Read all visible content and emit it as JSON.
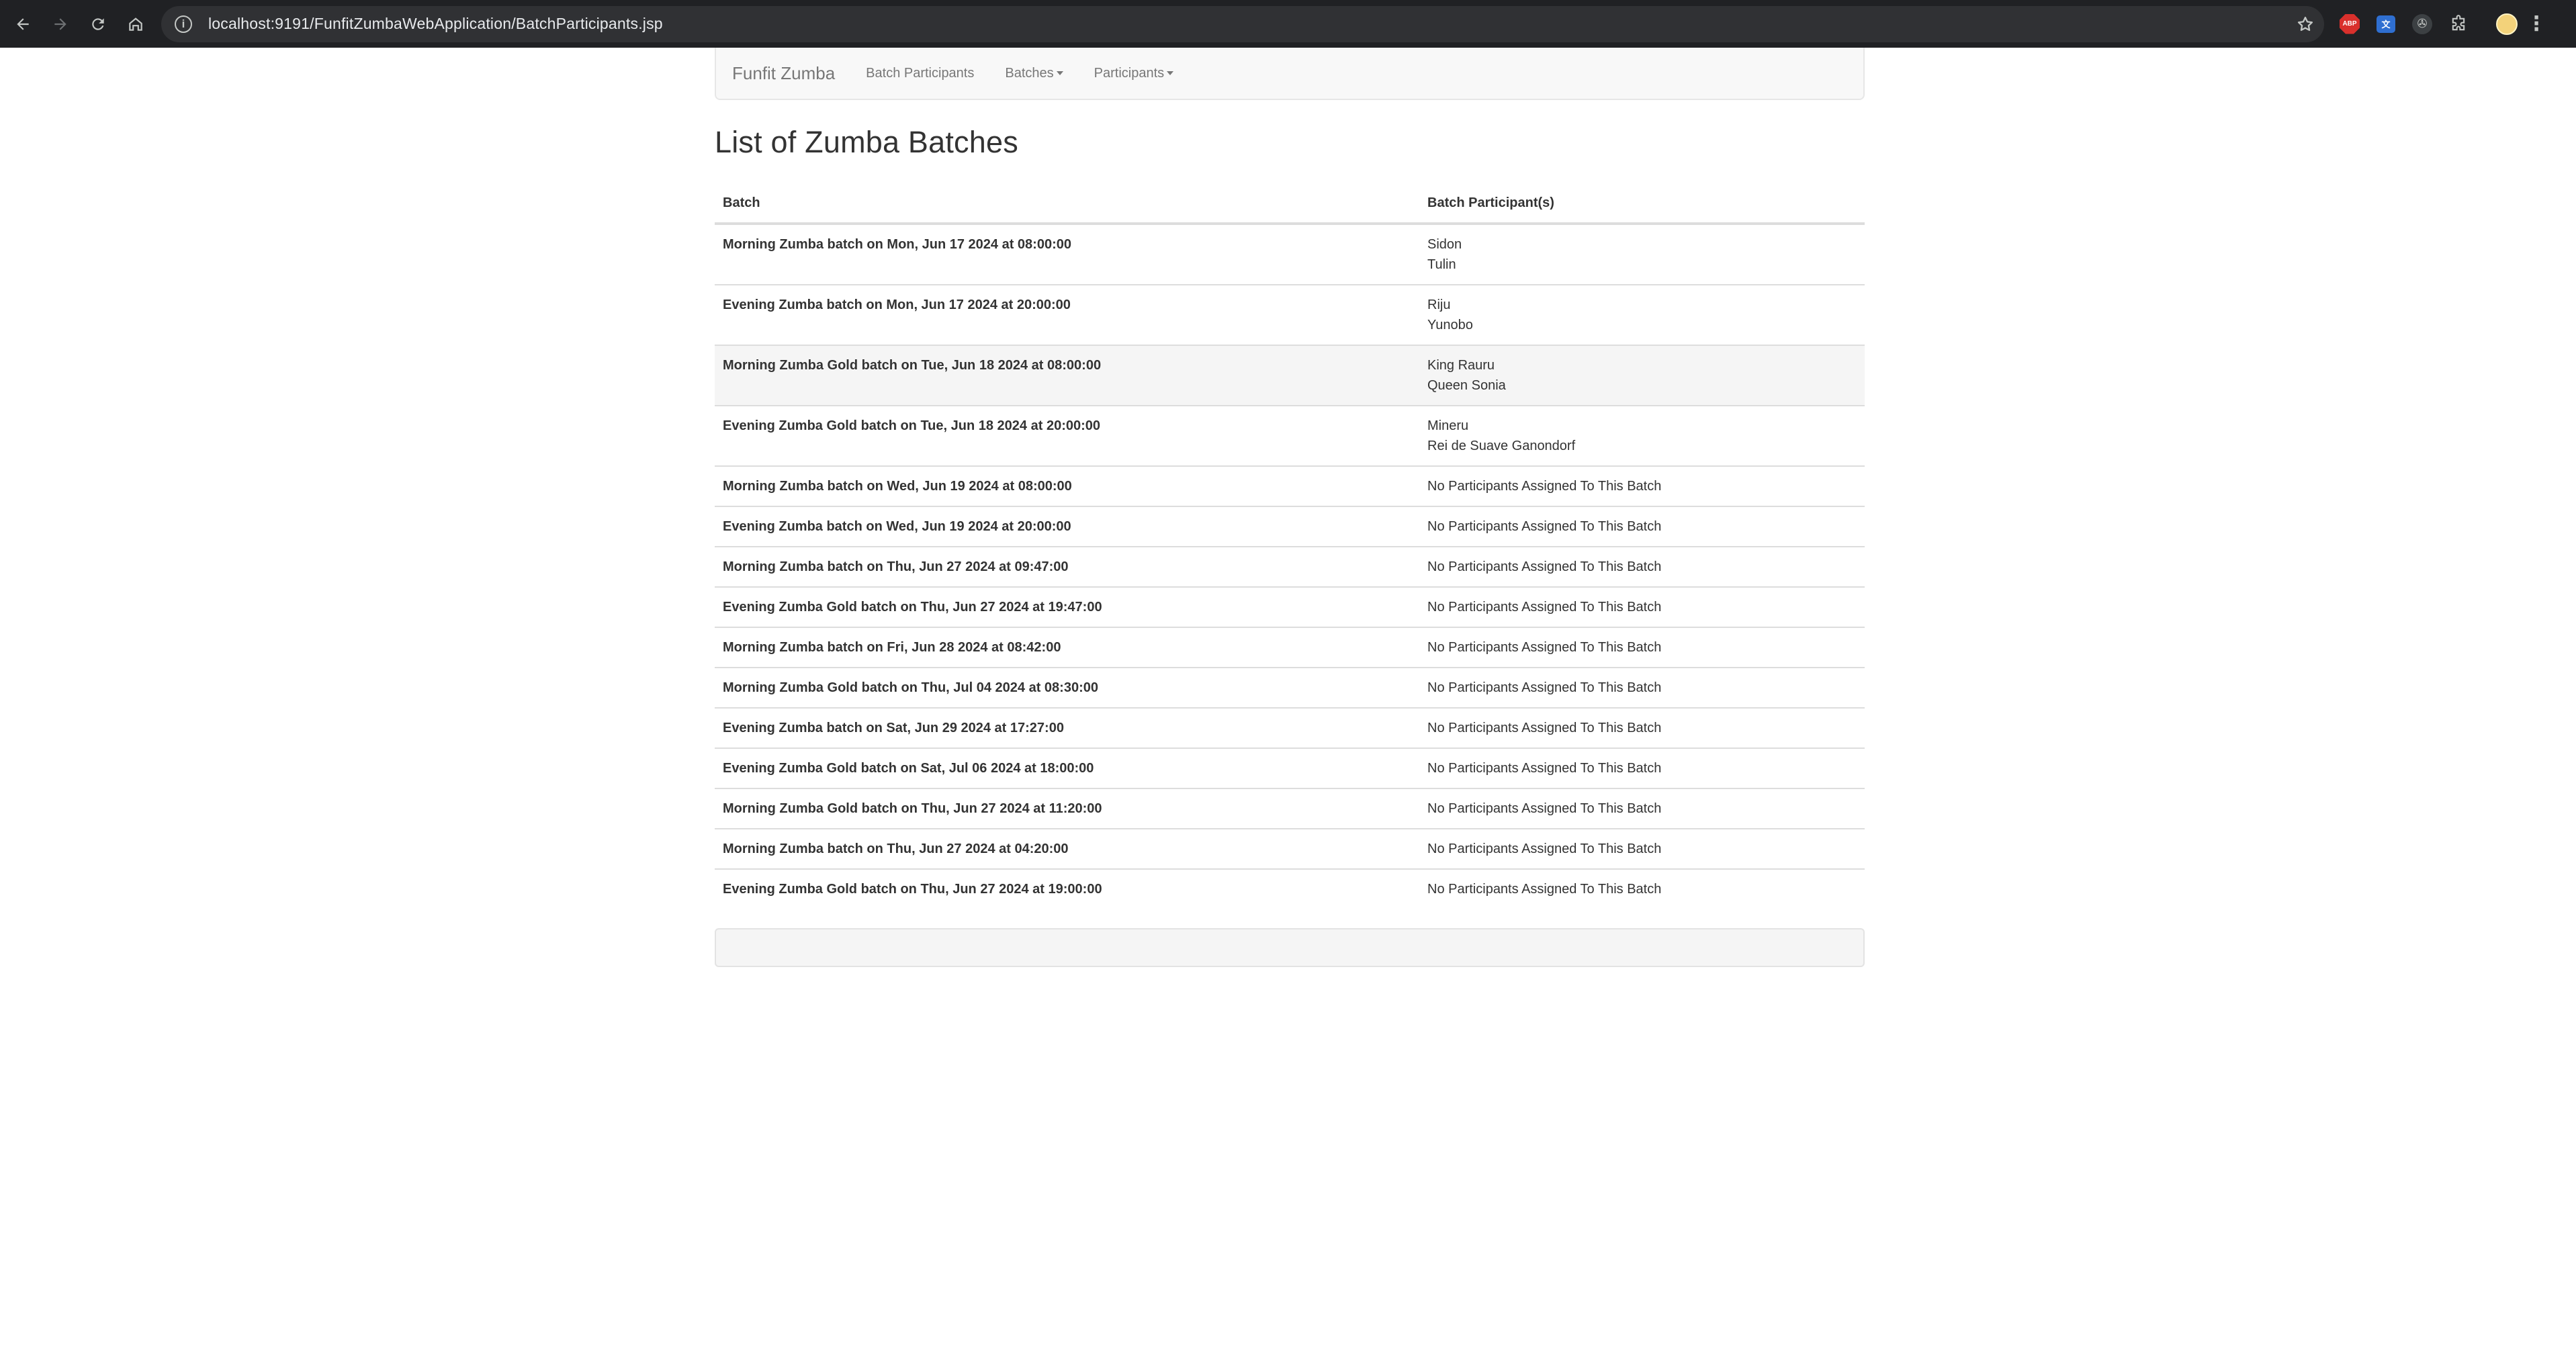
{
  "browser": {
    "url": "localhost:9191/FunfitZumbaWebApplication/BatchParticipants.jsp",
    "extensions": [
      "abp-icon",
      "translate-extension-icon",
      "dark-extension-icon",
      "puzzle-icon"
    ]
  },
  "navbar": {
    "brand": "Funfit Zumba",
    "items": [
      {
        "label": "Batch Participants",
        "dropdown": false
      },
      {
        "label": "Batches",
        "dropdown": true
      },
      {
        "label": "Participants",
        "dropdown": true
      }
    ]
  },
  "page": {
    "title": "List of Zumba Batches"
  },
  "table": {
    "headers": [
      "Batch",
      "Batch Participant(s)"
    ],
    "rows": [
      {
        "batch": "Morning Zumba batch on Mon, Jun 17 2024 at 08:00:00",
        "participants": [
          "Sidon",
          "Tulin"
        ]
      },
      {
        "batch": "Evening Zumba batch on Mon, Jun 17 2024 at 20:00:00",
        "participants": [
          "Riju",
          "Yunobo"
        ]
      },
      {
        "batch": "Morning Zumba Gold batch on Tue, Jun 18 2024 at 08:00:00",
        "participants": [
          "King Rauru",
          "Queen Sonia"
        ]
      },
      {
        "batch": "Evening Zumba Gold batch on Tue, Jun 18 2024 at 20:00:00",
        "participants": [
          "Mineru",
          "Rei de Suave Ganondorf"
        ]
      },
      {
        "batch": "Morning Zumba batch on Wed, Jun 19 2024 at 08:00:00",
        "participants": [
          "No Participants Assigned To This Batch"
        ]
      },
      {
        "batch": "Evening Zumba batch on Wed, Jun 19 2024 at 20:00:00",
        "participants": [
          "No Participants Assigned To This Batch"
        ]
      },
      {
        "batch": "Morning Zumba batch on Thu, Jun 27 2024 at 09:47:00",
        "participants": [
          "No Participants Assigned To This Batch"
        ]
      },
      {
        "batch": "Evening Zumba Gold batch on Thu, Jun 27 2024 at 19:47:00",
        "participants": [
          "No Participants Assigned To This Batch"
        ]
      },
      {
        "batch": "Morning Zumba batch on Fri, Jun 28 2024 at 08:42:00",
        "participants": [
          "No Participants Assigned To This Batch"
        ]
      },
      {
        "batch": "Morning Zumba Gold batch on Thu, Jul 04 2024 at 08:30:00",
        "participants": [
          "No Participants Assigned To This Batch"
        ]
      },
      {
        "batch": "Evening Zumba batch on Sat, Jun 29 2024 at 17:27:00",
        "participants": [
          "No Participants Assigned To This Batch"
        ]
      },
      {
        "batch": "Evening Zumba Gold batch on Sat, Jul 06 2024 at 18:00:00",
        "participants": [
          "No Participants Assigned To This Batch"
        ]
      },
      {
        "batch": "Morning Zumba Gold batch on Thu, Jun 27 2024 at 11:20:00",
        "participants": [
          "No Participants Assigned To This Batch"
        ]
      },
      {
        "batch": "Morning Zumba batch on Thu, Jun 27 2024 at 04:20:00",
        "participants": [
          "No Participants Assigned To This Batch"
        ]
      },
      {
        "batch": "Evening Zumba Gold batch on Thu, Jun 27 2024 at 19:00:00",
        "participants": [
          "No Participants Assigned To This Batch"
        ]
      }
    ],
    "highlighted_row": 2
  },
  "colors": {
    "chrome_bg": "#202124",
    "omnibox_bg": "#303134",
    "navbar_bg": "#f8f8f8",
    "text": "#333333",
    "nav_text": "#777777",
    "row_highlight": "#f5f5f5"
  }
}
